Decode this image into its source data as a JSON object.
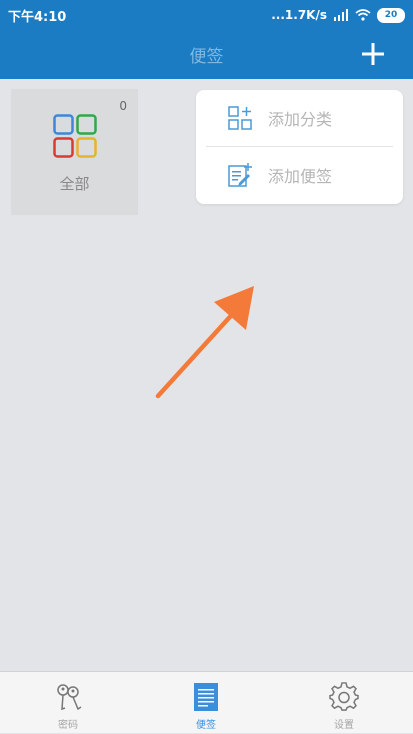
{
  "status_bar": {
    "time": "下午4:10",
    "network_speed": "...1.7K/s",
    "battery": "20"
  },
  "app_bar": {
    "title": "便签",
    "add_icon": "plus-icon"
  },
  "categories": [
    {
      "label": "全部",
      "count": "0",
      "icon": "four-squares-icon"
    }
  ],
  "popup_menu": {
    "items": [
      {
        "label": "添加分类",
        "icon": "add-category-icon"
      },
      {
        "label": "添加便签",
        "icon": "add-note-icon"
      }
    ]
  },
  "bottom_nav": {
    "tabs": [
      {
        "label": "密码",
        "icon": "keys-icon",
        "active": false
      },
      {
        "label": "便签",
        "icon": "note-icon",
        "active": true
      },
      {
        "label": "设置",
        "icon": "gear-icon",
        "active": false
      }
    ]
  },
  "colors": {
    "primary": "#1b7cc4",
    "arrow": "#f47a3a",
    "active_tab": "#3b8fd8"
  }
}
